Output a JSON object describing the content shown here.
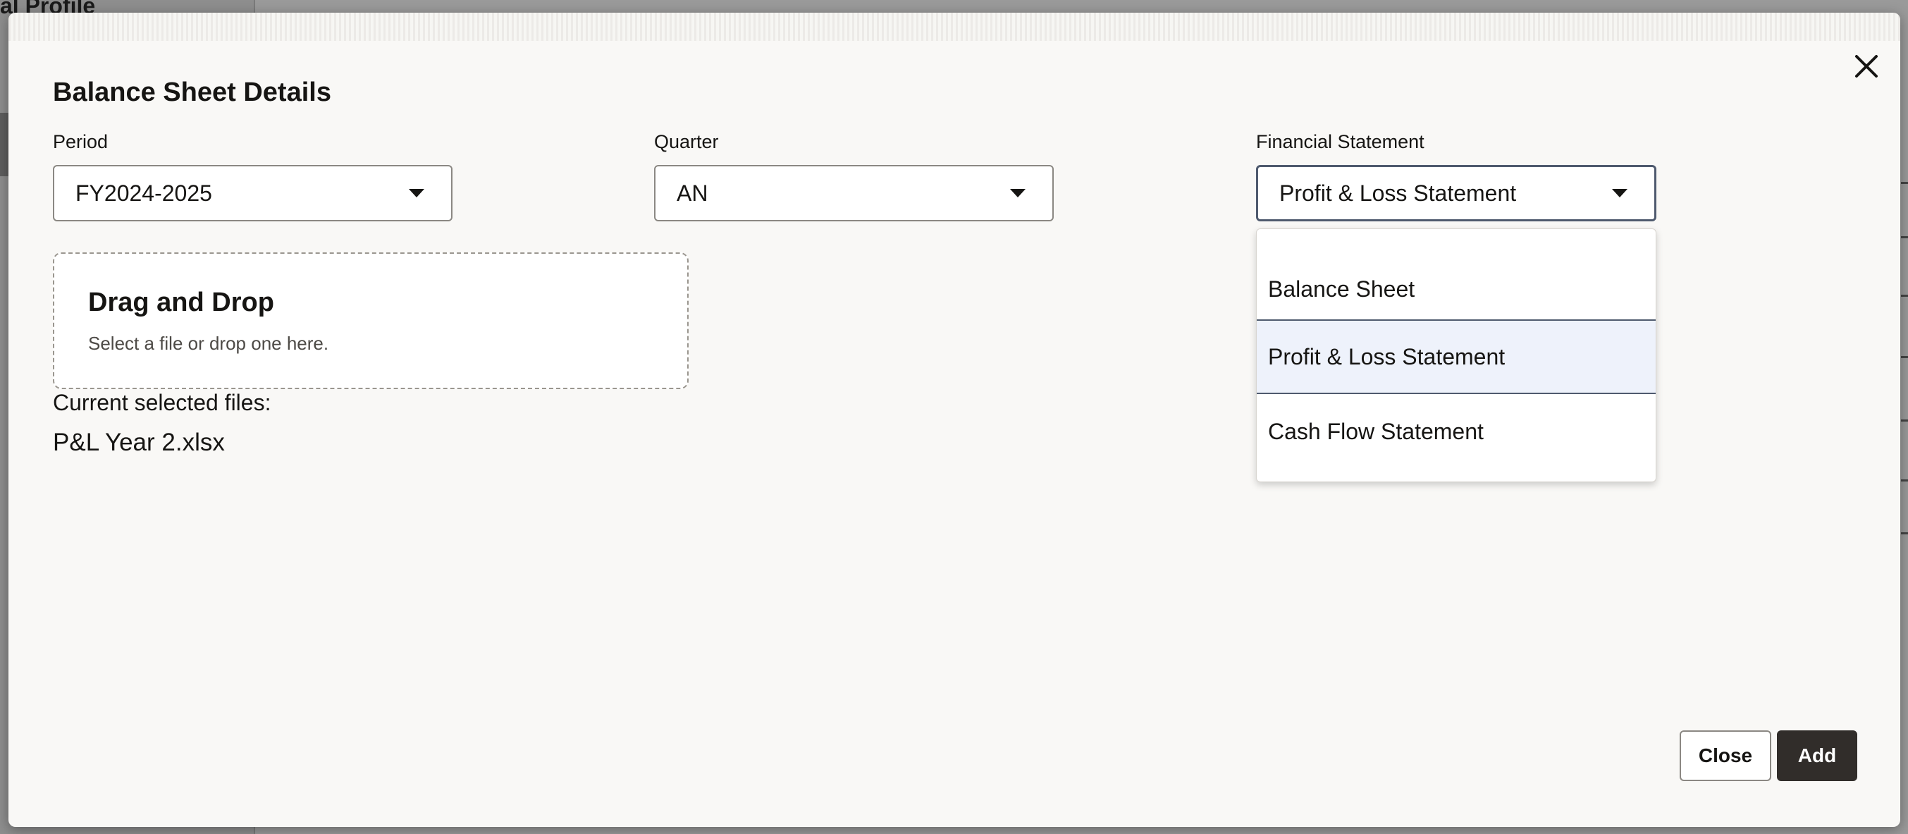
{
  "background": {
    "page_title": "al Profile"
  },
  "dialog": {
    "title": "Balance Sheet Details",
    "close_icon": "close-icon",
    "fields": {
      "period": {
        "label": "Period",
        "value": "FY2024-2025"
      },
      "quarter": {
        "label": "Quarter",
        "value": "AN"
      },
      "financial_statement": {
        "label": "Financial Statement",
        "value": "Profit & Loss Statement"
      }
    },
    "dropdown": {
      "options": [
        "Balance Sheet",
        "Profit & Loss Statement",
        "Cash Flow Statement"
      ],
      "selected": "Profit & Loss Statement"
    },
    "dropzone": {
      "title": "Drag and Drop",
      "subtitle": "Select a file or drop one here."
    },
    "files": {
      "label": "Current selected files:",
      "items": [
        "P&L Year 2.xlsx"
      ]
    },
    "buttons": {
      "close_label": "Close",
      "add_label": "Add"
    }
  },
  "colors": {
    "primary_button": "#312d2a",
    "focus_border": "#4f5a6e",
    "selected_option_bg": "#eef2fb"
  }
}
